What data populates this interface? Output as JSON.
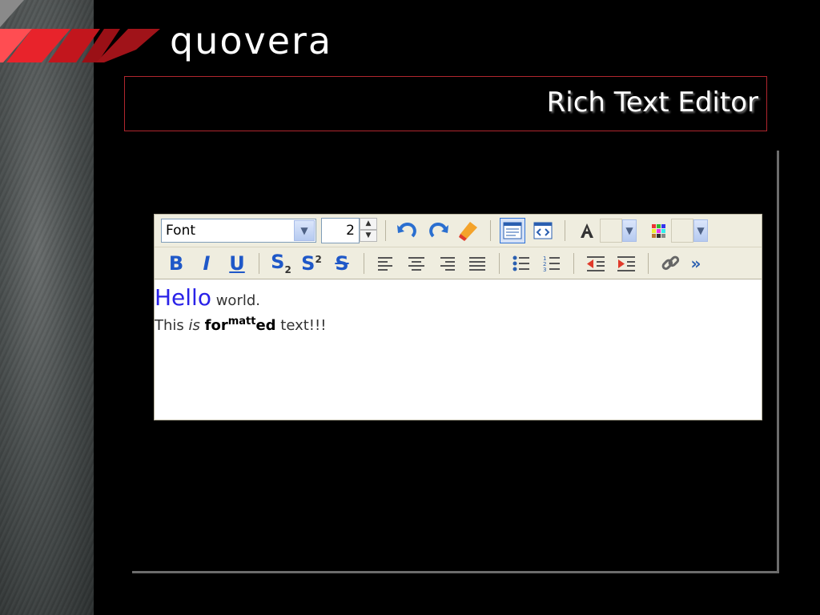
{
  "brand": {
    "logo_text": "quovera"
  },
  "slide": {
    "title": "Rich Text Editor"
  },
  "editor": {
    "font_select": {
      "label": "Font"
    },
    "font_size": {
      "value": "2"
    },
    "content": {
      "line1": {
        "hello": "Hello",
        "rest": " world."
      },
      "line2": {
        "this": "This ",
        "is": "is",
        "space": " ",
        "for": "for",
        "matt": "matt",
        "ed": "ed",
        "rest": " text!!!"
      }
    },
    "more_glyph": "»"
  },
  "colors": {
    "accent_red": "#b0262e",
    "icon_blue": "#1f58c8",
    "hello_blue": "#2a22e8"
  }
}
